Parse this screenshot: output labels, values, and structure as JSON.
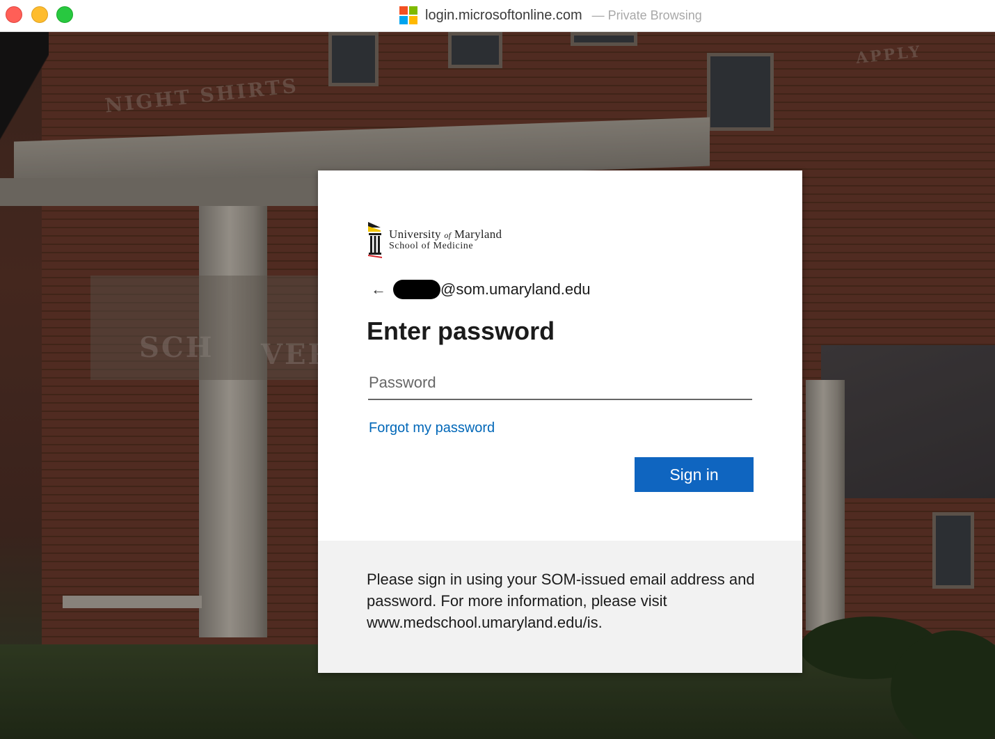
{
  "window": {
    "url": "login.microsoftonline.com",
    "mode_label": "— Private Browsing",
    "icon": "microsoft-logo-icon",
    "traffic_colors": [
      "#ff5f57",
      "#febc2e",
      "#28c840"
    ],
    "logo_colors": [
      "#f25022",
      "#7fba00",
      "#00a4ef",
      "#ffb900"
    ]
  },
  "background": {
    "scene": "brick building with white columns"
  },
  "card": {
    "org_logo": {
      "icon": "university-maryland-logo-icon"
    },
    "identity": {
      "back_icon": "←",
      "email_domain": "@som.umaryland.edu",
      "redacted": true
    },
    "heading": "Enter password",
    "password": {
      "placeholder": "Password",
      "value": ""
    },
    "forgot_link": "Forgot my password",
    "sign_in_button": "Sign in",
    "footer_text": "Please sign in using your SOM-issued email address and password. For more information, please visit www.medschool.umaryland.edu/is."
  },
  "colors": {
    "accent": "#0f65c0",
    "link": "#0067b8"
  },
  "logo_text": {
    "line1_a": "University",
    "line1_of": "of",
    "line1_b": "Maryland",
    "line2": "School of Medicine"
  }
}
